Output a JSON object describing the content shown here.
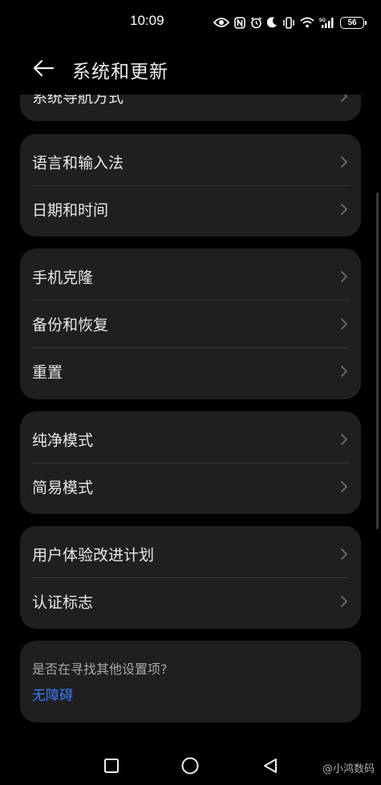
{
  "status_bar": {
    "time": "10:09",
    "battery": "56",
    "network": "5G"
  },
  "header": {
    "title": "系统和更新"
  },
  "groups": {
    "partial": {
      "item": "系统导航方式"
    },
    "g1": [
      "语言和输入法",
      "日期和时间"
    ],
    "g2": [
      "手机克隆",
      "备份和恢复",
      "重置"
    ],
    "g3": [
      "纯净模式",
      "简易模式"
    ],
    "g4": [
      "用户体验改进计划",
      "认证标志"
    ]
  },
  "suggestion": {
    "question": "是否在寻找其他设置项?",
    "link": "无障碍"
  },
  "watermark": "@小鸿数码",
  "colors": {
    "background": "#000000",
    "card": "#1f1f22",
    "link": "#3d7cf3"
  }
}
